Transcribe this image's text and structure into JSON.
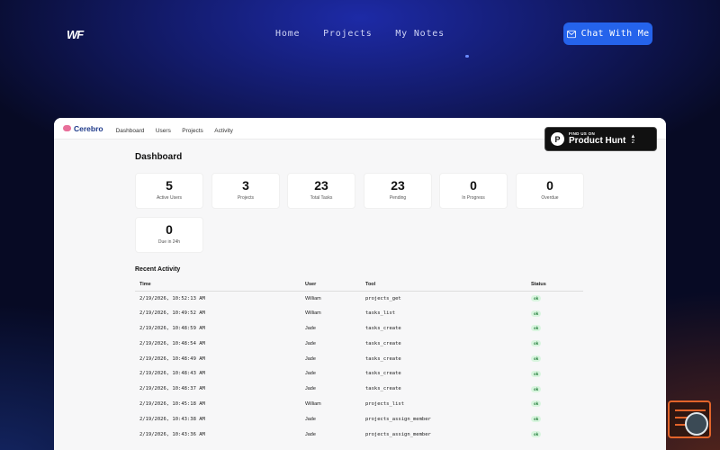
{
  "site": {
    "logo": "WF",
    "nav": [
      "Home",
      "Projects",
      "My Notes"
    ],
    "cta": "Chat With Me"
  },
  "app": {
    "brand": "Cerebro",
    "nav": [
      "Dashboard",
      "Users",
      "Projects",
      "Activity"
    ],
    "product_hunt": {
      "small": "FIND US ON",
      "big": "Product Hunt",
      "count": "2"
    },
    "title": "Dashboard",
    "stats": [
      {
        "value": "5",
        "label": "Active Users"
      },
      {
        "value": "3",
        "label": "Projects"
      },
      {
        "value": "23",
        "label": "Total Tasks"
      },
      {
        "value": "23",
        "label": "Pending"
      },
      {
        "value": "0",
        "label": "In Progress"
      },
      {
        "value": "0",
        "label": "Overdue"
      },
      {
        "value": "0",
        "label": "Due in 24h"
      }
    ],
    "recent_title": "Recent Activity",
    "columns": [
      "Time",
      "User",
      "Tool",
      "Status"
    ],
    "rows": [
      {
        "time": "2/19/2026, 10:52:13 AM",
        "user": "William",
        "tool": "projects_get",
        "status": "ok"
      },
      {
        "time": "2/19/2026, 10:49:52 AM",
        "user": "William",
        "tool": "tasks_list",
        "status": "ok"
      },
      {
        "time": "2/19/2026, 10:48:59 AM",
        "user": "Jade",
        "tool": "tasks_create",
        "status": "ok"
      },
      {
        "time": "2/19/2026, 10:48:54 AM",
        "user": "Jade",
        "tool": "tasks_create",
        "status": "ok"
      },
      {
        "time": "2/19/2026, 10:48:49 AM",
        "user": "Jade",
        "tool": "tasks_create",
        "status": "ok"
      },
      {
        "time": "2/19/2026, 10:48:43 AM",
        "user": "Jade",
        "tool": "tasks_create",
        "status": "ok"
      },
      {
        "time": "2/19/2026, 10:48:37 AM",
        "user": "Jade",
        "tool": "tasks_create",
        "status": "ok"
      },
      {
        "time": "2/19/2026, 10:45:18 AM",
        "user": "William",
        "tool": "projects_list",
        "status": "ok"
      },
      {
        "time": "2/19/2026, 10:43:38 AM",
        "user": "Jade",
        "tool": "projects_assign_member",
        "status": "ok"
      },
      {
        "time": "2/19/2026, 10:43:36 AM",
        "user": "Jade",
        "tool": "projects_assign_member",
        "status": "ok"
      }
    ]
  },
  "colors": {
    "accent": "#2563eb",
    "ok_bg": "#d9f5df",
    "ok_text": "#1e7a36"
  }
}
